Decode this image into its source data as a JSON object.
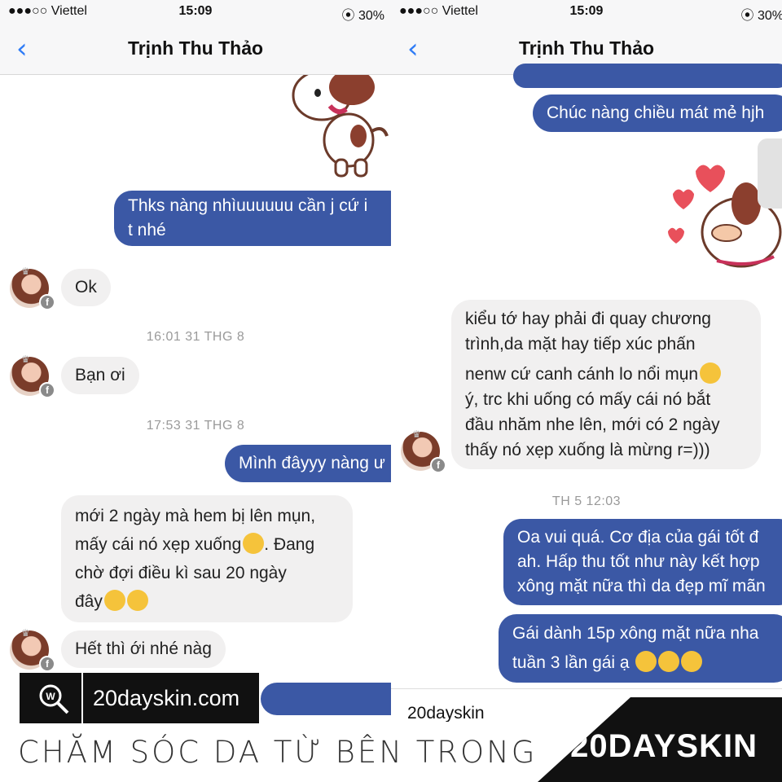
{
  "left": {
    "status": {
      "carrier": "●●●○○ Viettel ",
      "time": "15:09",
      "battery": "30%"
    },
    "nav": {
      "back": "‹",
      "title": "Trịnh Thu Thảo"
    },
    "messages": {
      "out1_line1": "Thks nàng nhìuuuuuu cần j cứ i",
      "out1_line2": "t nhé",
      "in_ok": "Ok",
      "ts1": "16:01 31 THG 8",
      "in_banoi": "Bạn ơi",
      "ts2": "17:53 31 THG 8",
      "out_minh": "Mình đâyyy nàng ư",
      "in_moi_1": "mới 2 ngày mà hem bị lên mụn,",
      "in_moi_2": "mấy cái nó xẹp xuống",
      "in_moi_2b": ". Đang",
      "in_moi_3": "chờ đợi điều kì sau 20 ngày",
      "in_moi_4": "đây",
      "in_het": "Hết thì ới nhé nàg"
    },
    "fb_badge": "f"
  },
  "right": {
    "status": {
      "carrier": "●●●○○ Viettel ",
      "time": "15:09",
      "battery": "30%"
    },
    "nav": {
      "back": "‹",
      "title": "Trịnh Thu Thảo"
    },
    "messages": {
      "out_chuc": "Chúc nàng chiều mát mẻ hjh",
      "in_1": "kiểu tớ hay phải đi quay chương",
      "in_2": "trình,da mặt hay tiếp xúc phấn",
      "in_3": "nenw cứ canh cánh lo nổi mụn",
      "in_4": "ý, trc khi uống có mấy cái nó bắt",
      "in_5": "đầu nhăm nhe lên, mới có 2 ngày",
      "in_6": "thấy nó xẹp xuống là mừng r=)))",
      "ts": "TH 5 12:03",
      "out_oa_1": "Oa vui quá. Cơ địa của gái tốt đ",
      "out_oa_2": "ah. Hấp thu tốt như này kết hợp",
      "out_oa_3": "xông mặt nữa thì da đẹp mĩ mãn",
      "out_gai_1": "Gái dành 15p xông mặt nữa nha",
      "out_gai_2": "tuần 3 lần gái ạ"
    },
    "footer_label": "20dayskin"
  },
  "branding": {
    "slogan": "CHĂM SÓC DA TỪ BÊN TRONG",
    "brand": "20DAYSKIN",
    "website": "20dayskin.com"
  },
  "colors": {
    "outgoing": "#3b58a5",
    "incoming": "#f1f0f0",
    "accent": "#2f7cf6"
  }
}
